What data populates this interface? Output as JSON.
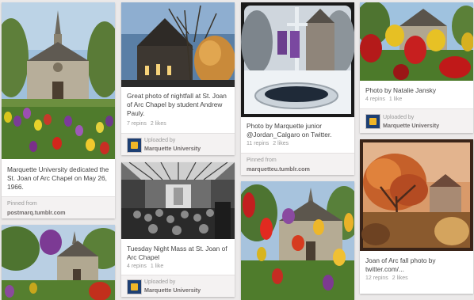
{
  "pins": [
    {
      "description": "Marquette University dedicated the St. Joan of Arc Chapel on May 26, 1966.",
      "pinned_label": "Pinned from",
      "source": "postmarq.tumblr.com"
    },
    {
      "description": "Great photo of nightfall at St. Joan of Arc Chapel by student Andrew Pauly.",
      "repins": "7 repins",
      "likes": "2 likes",
      "uploaded_label": "Uploaded by",
      "uploader": "Marquette University"
    },
    {
      "description": "Photo by Marquette junior @Jordan_Calgaro on Twitter.",
      "repins": "11 repins",
      "likes": "2 likes",
      "pinned_label": "Pinned from",
      "source": "marquetteu.tumblr.com"
    },
    {
      "description": "Photo by Natalie Jansky",
      "repins": "4 repins",
      "likes": "1 like",
      "uploaded_label": "Uploaded by",
      "uploader": "Marquette University"
    },
    {
      "description": "Tuesday Night Mass at St. Joan of Arc Chapel",
      "repins": "4 repins",
      "likes": "1 like",
      "uploaded_label": "Uploaded by",
      "uploader": "Marquette University"
    },
    {
      "description": "Joan of Arc fall photo by twitter.com/...",
      "repins": "12 repins",
      "likes": "2 likes"
    }
  ],
  "colors": {
    "background": "#ebe9e9",
    "avatar_blue": "#1d3f73",
    "avatar_gold": "#f0b628"
  },
  "icons": {
    "uploader_avatar": "marquette-logo-icon"
  }
}
